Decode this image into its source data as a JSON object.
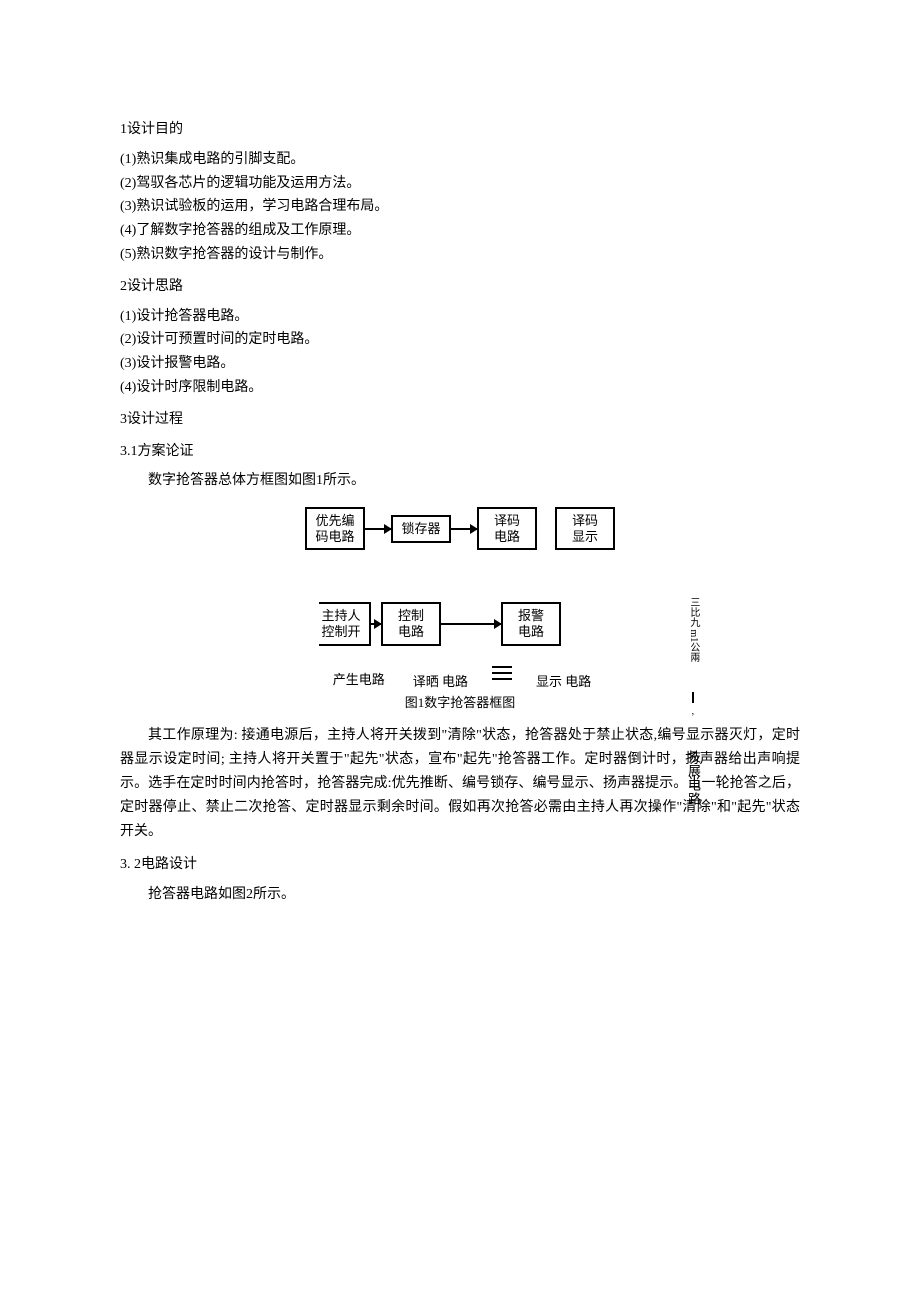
{
  "sections": {
    "s1": {
      "title": "1设计目的",
      "items": [
        "(1)熟识集成电路的引脚支配。",
        "(2)驾驭各芯片的逻辑功能及运用方法。",
        "(3)熟识试验板的运用，学习电路合理布局。",
        "(4)了解数字抢答器的组成及工作原理。",
        "(5)熟识数字抢答器的设计与制作。"
      ]
    },
    "s2": {
      "title": "2设计思路",
      "items": [
        "(1)设计抢答器电路。",
        "(2)设计可预置时间的定时电路。",
        "(3)设计报警电路。",
        "(4)设计时序限制电路。"
      ]
    },
    "s3": {
      "title": "3设计过程",
      "s31": {
        "title": "3.1方案论证",
        "intro": "数字抢答器总体方框图如图1所示。"
      },
      "s32": {
        "title": "3. 2电路设计",
        "intro": "抢答器电路如图2所示。"
      }
    }
  },
  "diagram": {
    "caption": "图1数字抢答器框图",
    "row1": {
      "b1": "优先编\n码电路",
      "b2": "锁存器",
      "b3": "译码\n电路",
      "b4": "译码\n显示"
    },
    "row2": {
      "b1": "主持人\n控制开",
      "b2": "控制\n电路",
      "b3": "报警\n电路"
    },
    "side": {
      "tag": "三比九 m1公兩",
      "vlabel": "技展电路"
    },
    "row3": {
      "b1": "产生电路",
      "b2": "译晒\n电路",
      "b3": "显示\n电路"
    }
  },
  "principle": "其工作原理为: 接通电源后，主持人将开关拨到\"清除\"状态，抢答器处于禁止状态,编号显示器灭灯，定时器显示设定时间; 主持人将开关置于\"起先\"状态，宣布\"起先\"抢答器工作。定时器倒计时，扬声器给出声响提示。选手在定时时间内抢答时，抢答器完成:优先推断、编号锁存、编号显示、扬声器提示。当一轮抢答之后，定时器停止、禁止二次抢答、定时器显示剩余时间。假如再次抢答必需由主持人再次操作\"清除\"和\"起先\"状态开关。"
}
